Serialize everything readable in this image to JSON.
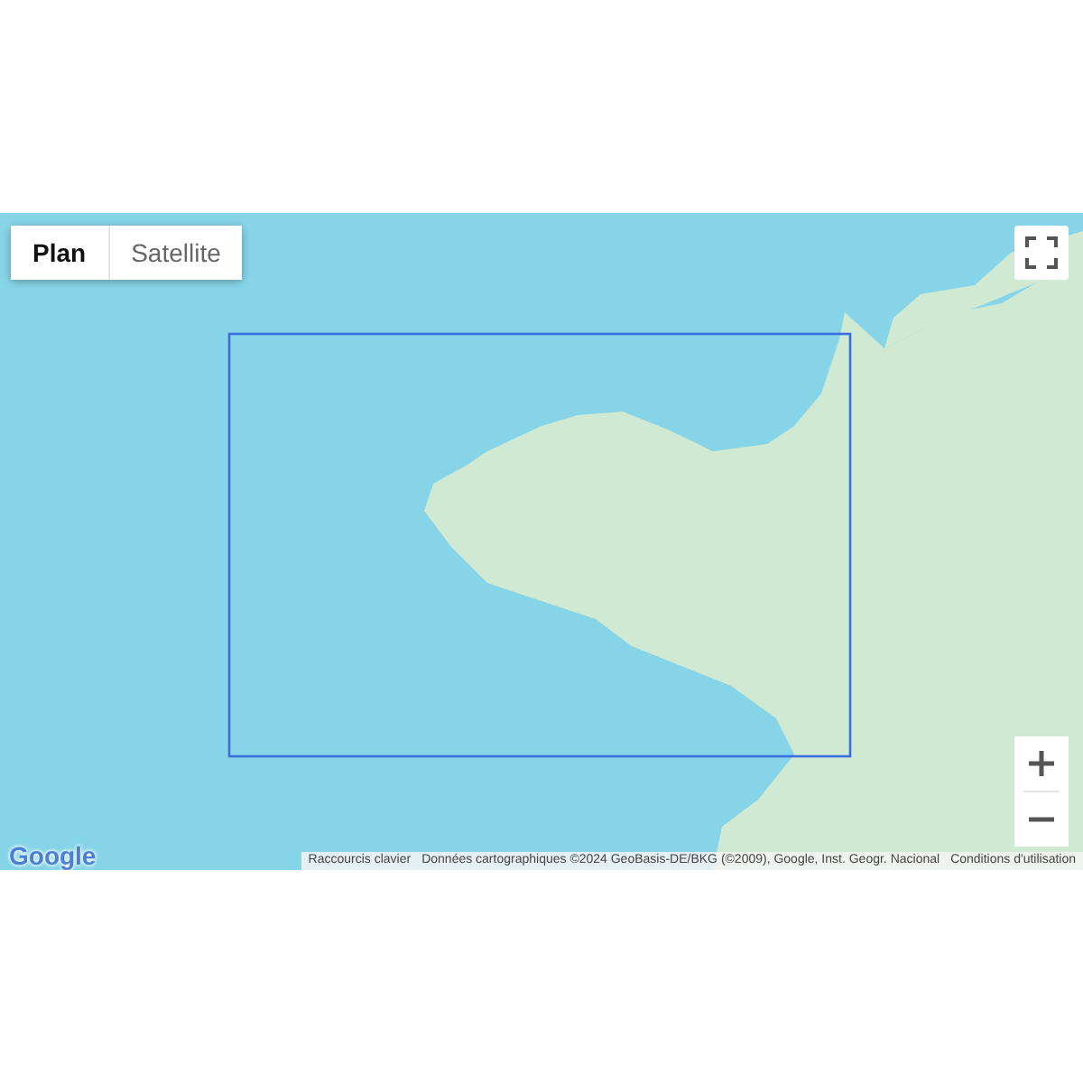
{
  "map_type_tabs": [
    {
      "label": "Plan",
      "selected": true
    },
    {
      "label": "Satellite",
      "selected": false
    }
  ],
  "logo": "Google",
  "attribution": {
    "shortcuts": "Raccourcis clavier",
    "data": "Données cartographiques ©2024 GeoBasis-DE/BKG (©2009), Google, Inst. Geogr. Nacional",
    "terms": "Conditions d'utilisation"
  }
}
